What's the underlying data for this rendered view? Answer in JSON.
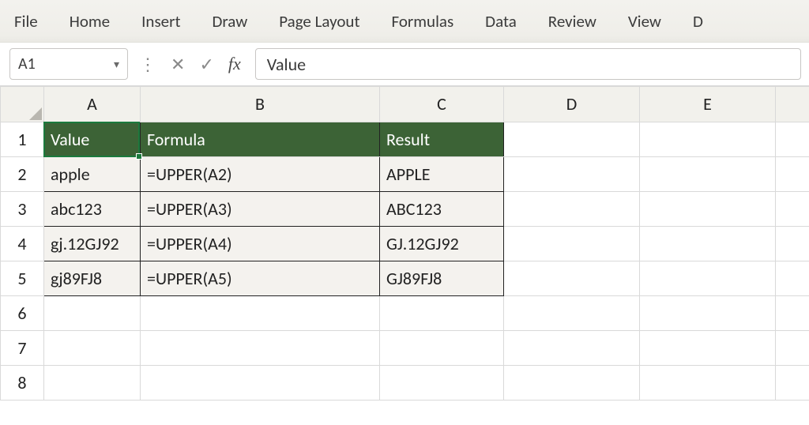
{
  "ribbon": {
    "tabs": [
      "File",
      "Home",
      "Insert",
      "Draw",
      "Page Layout",
      "Formulas",
      "Data",
      "Review",
      "View",
      "D"
    ]
  },
  "formula_row": {
    "name_box": "A1",
    "formula_bar": "Value",
    "vdots": "⋮",
    "x": "✕",
    "check": "✓",
    "fx": "fx"
  },
  "grid": {
    "columns": [
      "A",
      "B",
      "C",
      "D",
      "E"
    ],
    "row_numbers": [
      "1",
      "2",
      "3",
      "4",
      "5",
      "6",
      "7",
      "8"
    ],
    "headers": {
      "A": "Value",
      "B": "Formula",
      "C": "Result"
    },
    "rows": [
      {
        "A": "apple",
        "B": "=UPPER(A2)",
        "C": "APPLE"
      },
      {
        "A": "abc123",
        "B": "=UPPER(A3)",
        "C": "ABC123"
      },
      {
        "A": "gj.12GJ92",
        "B": "=UPPER(A4)",
        "C": "GJ.12GJ92"
      },
      {
        "A": "gj89FJ8",
        "B": "=UPPER(A5)",
        "C": "GJ89FJ8"
      }
    ]
  },
  "colors": {
    "table_header_bg": "#3c6336",
    "selection": "#1b7a3d"
  },
  "active_cell": "A1"
}
